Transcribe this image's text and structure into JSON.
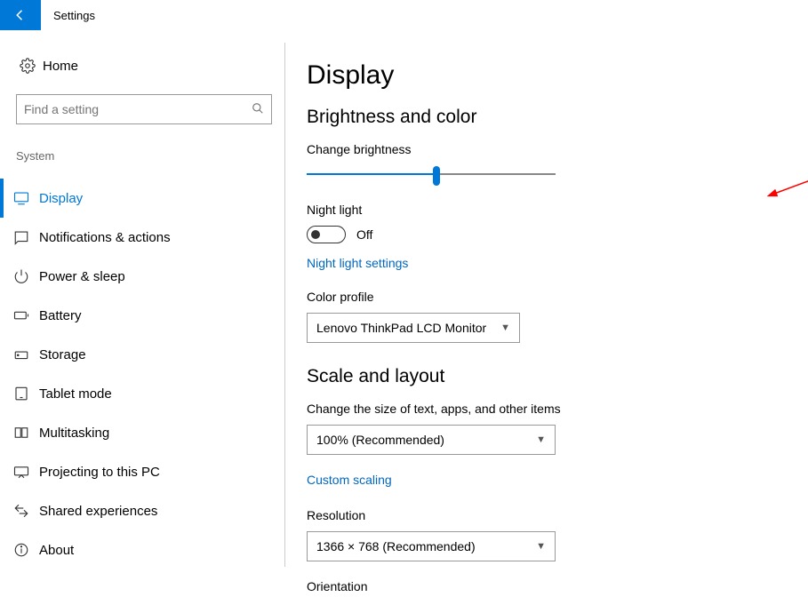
{
  "window": {
    "title": "Settings"
  },
  "sidebar": {
    "home_label": "Home",
    "search_placeholder": "Find a setting",
    "category": "System",
    "items": [
      {
        "label": "Display",
        "icon": "display-icon",
        "active": true
      },
      {
        "label": "Notifications & actions",
        "icon": "notifications-icon"
      },
      {
        "label": "Power & sleep",
        "icon": "power-icon"
      },
      {
        "label": "Battery",
        "icon": "battery-icon"
      },
      {
        "label": "Storage",
        "icon": "storage-icon"
      },
      {
        "label": "Tablet mode",
        "icon": "tablet-icon"
      },
      {
        "label": "Multitasking",
        "icon": "multitasking-icon"
      },
      {
        "label": "Projecting to this PC",
        "icon": "projecting-icon"
      },
      {
        "label": "Shared experiences",
        "icon": "shared-icon"
      },
      {
        "label": "About",
        "icon": "about-icon"
      }
    ]
  },
  "page": {
    "title": "Display",
    "section_brightness": "Brightness and color",
    "brightness_label": "Change brightness",
    "brightness_percent": 52,
    "night_light_label": "Night light",
    "night_light_state": "Off",
    "night_light_link": "Night light settings",
    "color_profile_label": "Color profile",
    "color_profile_value": "Lenovo ThinkPad LCD Monitor",
    "section_scale": "Scale and layout",
    "scale_label": "Change the size of text, apps, and other items",
    "scale_value": "100% (Recommended)",
    "custom_scaling_link": "Custom scaling",
    "resolution_label": "Resolution",
    "resolution_value": "1366 × 768 (Recommended)",
    "orientation_label": "Orientation"
  }
}
